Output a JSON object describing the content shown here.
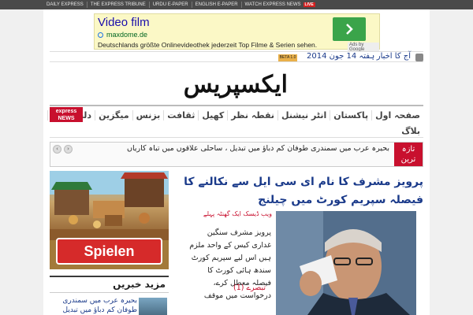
{
  "topbar": {
    "links": [
      "DAILY EXPRESS",
      "THE EXPRESS TRIBUNE",
      "URDU E-PAPER",
      "ENGLISH E-PAPER",
      "WATCH EXPRESS NEWS"
    ],
    "live_badge": "LIVE"
  },
  "ad": {
    "title": "Video film",
    "url": "maxdome.de",
    "text": "Deutschlands größte Onlinevideothek jederzeit Top Filme & Serien sehen.",
    "badge": "Ads by Google"
  },
  "daterow": {
    "beta": "BETA 1.0",
    "date": "ہفتہ 14 جون 2014",
    "today_label": "آج کا اخبار"
  },
  "logo": {
    "text": "ایکسپریس"
  },
  "nav": {
    "items": [
      "صفحہ اول",
      "پاکستان",
      "انٹر نیشنل",
      "نقطہ نظر",
      "کھیل",
      "ثقافت",
      "بزنس",
      "میگزین",
      "دلچسپ و"
    ],
    "row2": "بلاگ",
    "express_news_logo": "express NEWS"
  },
  "ticker": {
    "label": "تازہ ترین",
    "text": "بحیرہ عرب میں سمندری طوفان کم دباؤ میں تبدیل ، ساحلی علاقوں میں تباہ کاریاں",
    "prev": "‹",
    "next": "›"
  },
  "left": {
    "game_button": "Spielen",
    "more_title": "مزید خبریں",
    "more_item_text": "بحیرہ عرب میں سمندری طوفان کم دباؤ میں تبدیل"
  },
  "story": {
    "headline": "پرویز مشرف کا نام ای سی ایل سے نکالنے کا فیصلہ سپریم کورٹ میں چیلنج",
    "byline": "ویب ڈیسک  ایک گھنٹہ پہلے",
    "excerpt": "پرویز مشرف سنگین غداری کیس کے واحد ملزم ہیں اس لیے سپریم کورٹ سندھ ہائی کورٹ کا فیصلہ معطل کرے، درخواست میں موقف",
    "comments": "تبصرے (1)"
  },
  "colors": {
    "brand_red": "#c8102e",
    "link_blue": "#1a3a8a",
    "ad_bg": "#fbf8c6"
  }
}
